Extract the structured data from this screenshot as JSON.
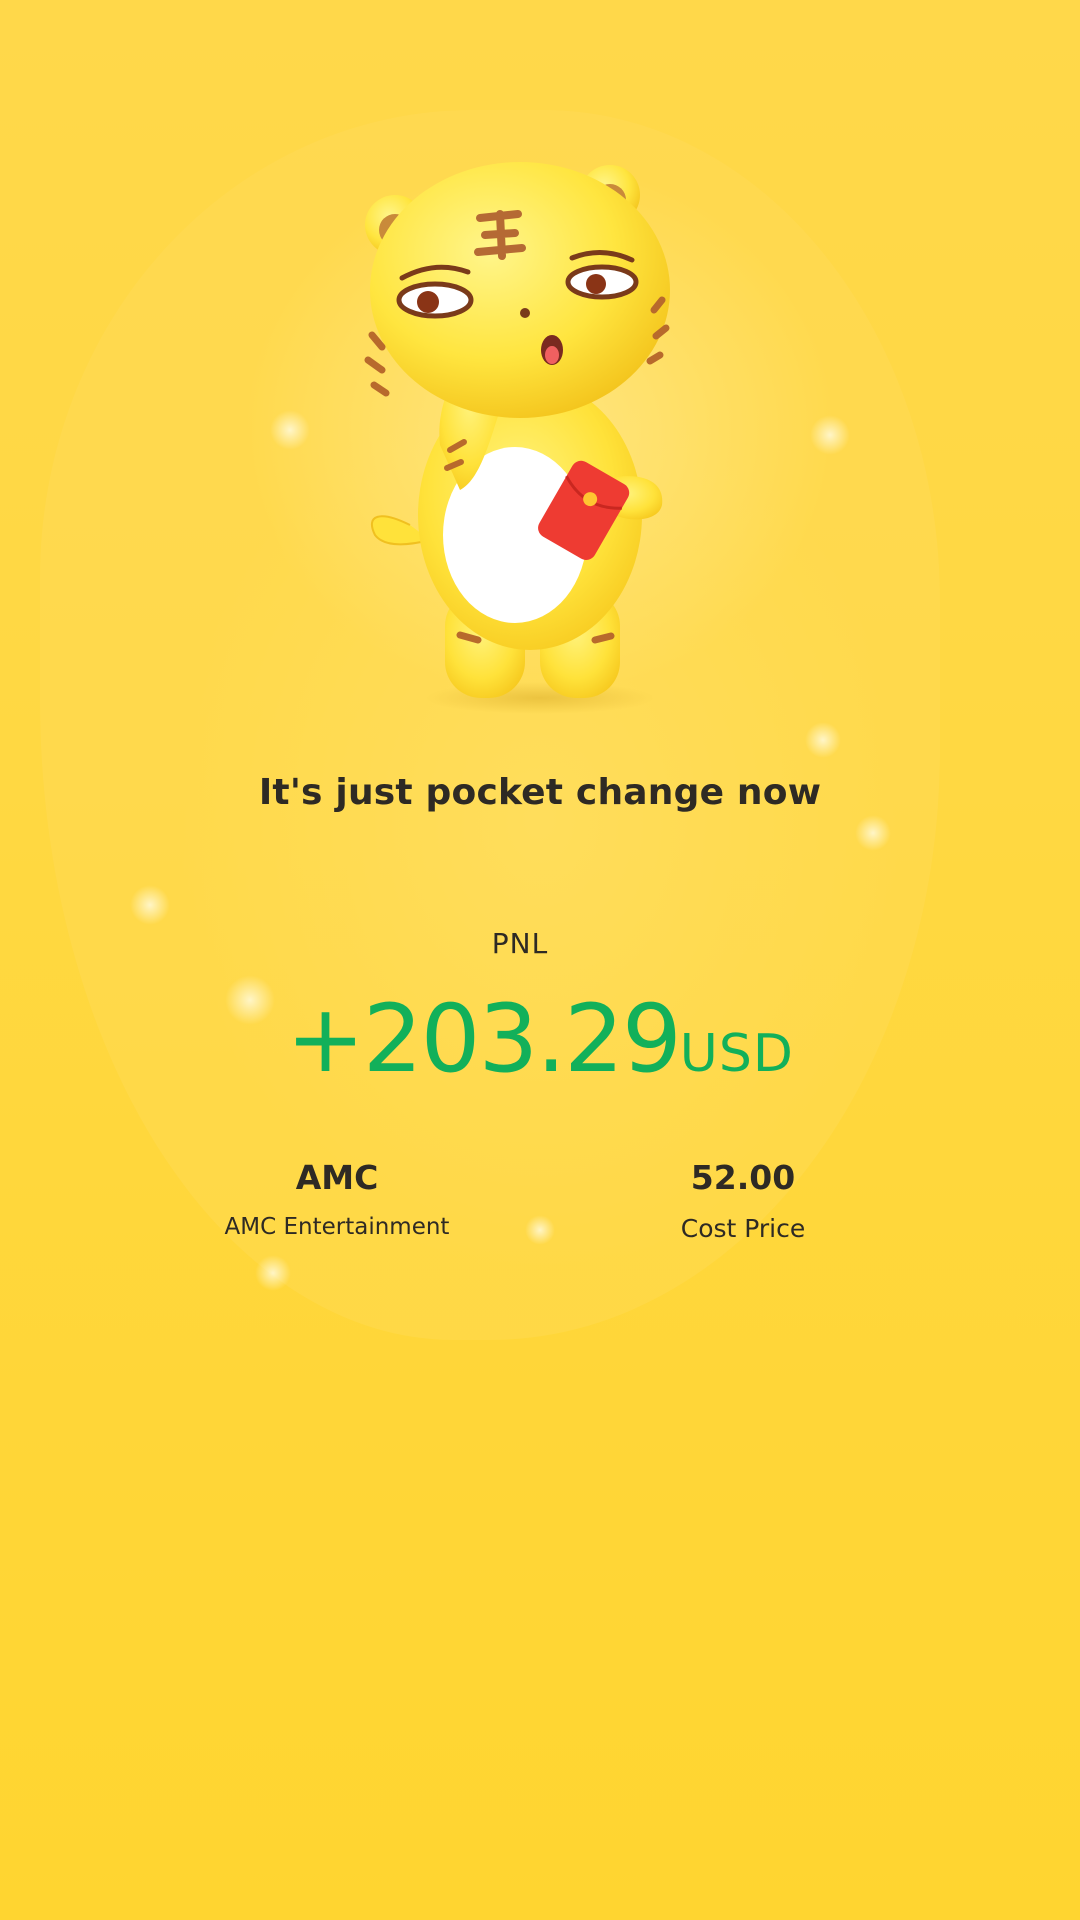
{
  "screen": {
    "background_color": "#ffd842",
    "accent_color": "#12b05a",
    "text_color": "#2e2a24"
  },
  "mascot": {
    "icon": "tiger-mascot-icon",
    "holding": "red-envelope-icon"
  },
  "headline": "It's just pocket change now",
  "pnl": {
    "label": "PNL",
    "amount": "+203.29",
    "currency": "USD"
  },
  "stock": {
    "symbol": "AMC",
    "name": "AMC Entertainment"
  },
  "cost": {
    "value": "52.00",
    "label": "Cost Price"
  }
}
